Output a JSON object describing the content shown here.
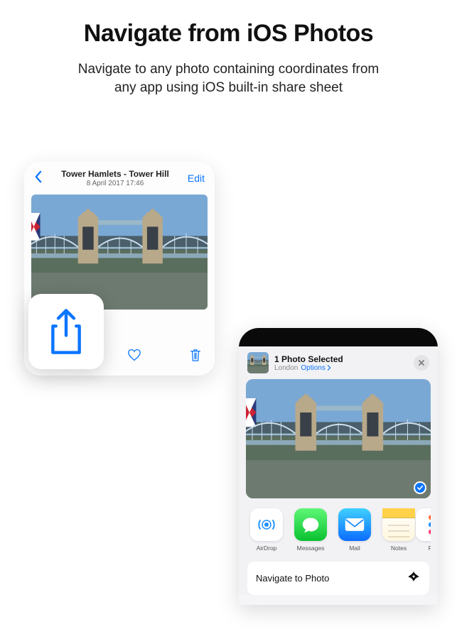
{
  "heading": "Navigate from iOS Photos",
  "subheading_line1": "Navigate to any photo containing coordinates from",
  "subheading_line2": "any app using iOS built-in share sheet",
  "photos_detail": {
    "title": "Tower Hamlets - Tower Hill",
    "subtitle": "8 April 2017  17:46",
    "edit_label": "Edit"
  },
  "share_sheet": {
    "title": "1 Photo Selected",
    "location": "London",
    "options_label": "Options",
    "apps": [
      {
        "label": "AirDrop"
      },
      {
        "label": "Messages"
      },
      {
        "label": "Mail"
      },
      {
        "label": "Notes"
      },
      {
        "label": "Re"
      }
    ],
    "action_label": "Navigate to Photo"
  },
  "colors": {
    "ios_blue": "#0b75ff"
  }
}
